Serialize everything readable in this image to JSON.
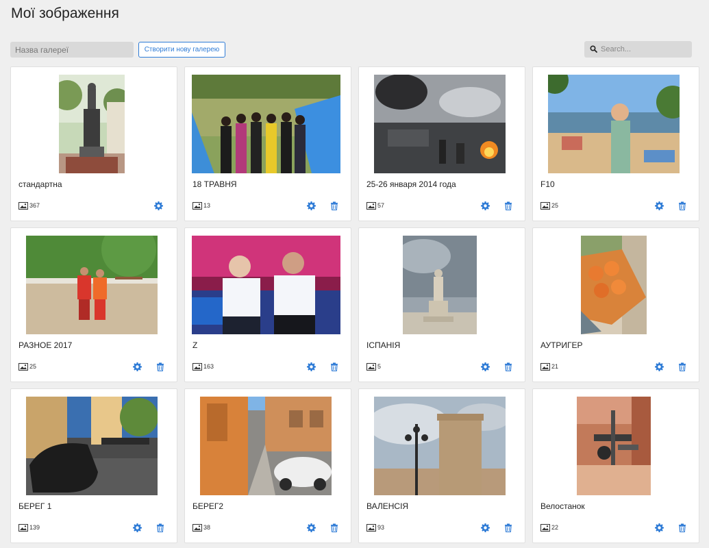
{
  "page": {
    "title": "Мої зображення"
  },
  "toolbar": {
    "gallery_name_placeholder": "Назва галереї",
    "create_label": "Створити нову галерею",
    "search_placeholder": "Search..."
  },
  "colors": {
    "accent": "#2e7bd6",
    "page_bg": "#efefef",
    "input_bg": "#d9d9d9"
  },
  "galleries": [
    {
      "title": "стандартна",
      "count": "367",
      "deletable": false
    },
    {
      "title": "18 ТРАВНЯ",
      "count": "13",
      "deletable": true
    },
    {
      "title": "25-26 января 2014 года",
      "count": "57",
      "deletable": true
    },
    {
      "title": "F10",
      "count": "25",
      "deletable": true
    },
    {
      "title": "РАЗНОЕ 2017",
      "count": "25",
      "deletable": true
    },
    {
      "title": "Z",
      "count": "163",
      "deletable": true
    },
    {
      "title": "ІСПАНІЯ",
      "count": "5",
      "deletable": true
    },
    {
      "title": "АУТРИГЕР",
      "count": "21",
      "deletable": true
    },
    {
      "title": "БЕРЕГ 1",
      "count": "139",
      "deletable": true
    },
    {
      "title": "БЕРЕГ2",
      "count": "38",
      "deletable": true
    },
    {
      "title": "ВАЛЕНСІЯ",
      "count": "93",
      "deletable": true
    },
    {
      "title": "Велостанок",
      "count": "22",
      "deletable": true
    }
  ]
}
